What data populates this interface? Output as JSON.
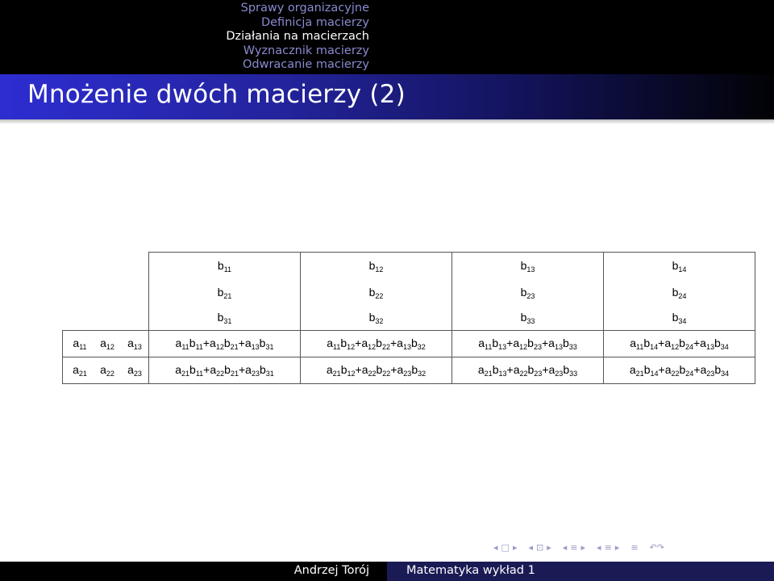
{
  "nav": {
    "sections": [
      "Sprawy organizacyjne",
      "Definicja macierzy",
      "Działania na macierzach",
      "Wyznacznik macierzy",
      "Odwracanie macierzy"
    ],
    "active_index": 2
  },
  "frame": {
    "title": "Mnożenie dwóch macierzy (2)"
  },
  "table": {
    "b_matrix": [
      [
        [
          "b",
          "11"
        ],
        [
          "b",
          "12"
        ],
        [
          "b",
          "13"
        ],
        [
          "b",
          "14"
        ]
      ],
      [
        [
          "b",
          "21"
        ],
        [
          "b",
          "22"
        ],
        [
          "b",
          "23"
        ],
        [
          "b",
          "24"
        ]
      ],
      [
        [
          "b",
          "31"
        ],
        [
          "b",
          "32"
        ],
        [
          "b",
          "33"
        ],
        [
          "b",
          "34"
        ]
      ]
    ],
    "a_rows": [
      {
        "a": [
          [
            "a",
            "11"
          ],
          [
            "a",
            "12"
          ],
          [
            "a",
            "13"
          ]
        ],
        "products": [
          "a_{11}b_{11}+a_{12}b_{21}+a_{13}b_{31}",
          "a_{11}b_{12}+a_{12}b_{22}+a_{13}b_{32}",
          "a_{11}b_{13}+a_{12}b_{23}+a_{13}b_{33}",
          "a_{11}b_{14}+a_{12}b_{24}+a_{13}b_{34}"
        ]
      },
      {
        "a": [
          [
            "a",
            "21"
          ],
          [
            "a",
            "22"
          ],
          [
            "a",
            "23"
          ]
        ],
        "products": [
          "a_{21}b_{11}+a_{22}b_{21}+a_{23}b_{31}",
          "a_{21}b_{12}+a_{22}b_{22}+a_{23}b_{32}",
          "a_{21}b_{13}+a_{22}b_{23}+a_{23}b_{33}",
          "a_{21}b_{14}+a_{22}b_{24}+a_{23}b_{34}"
        ]
      }
    ]
  },
  "nav_symbols": [
    "◂",
    "□",
    "▸",
    "◂",
    "⊡",
    "▸",
    "◂",
    "≡",
    "▸",
    "◂",
    "≡",
    "▸",
    "≡",
    "↶↷"
  ],
  "footer": {
    "author": "Andrzej Torój",
    "course": "Matematyka wykład 1"
  },
  "colors": {
    "nav_inactive": "#8a8ad0",
    "nav_active": "#ffffff",
    "title_gradient_start": "#2d2dd1",
    "footer_right_bg": "#1a1a55"
  }
}
